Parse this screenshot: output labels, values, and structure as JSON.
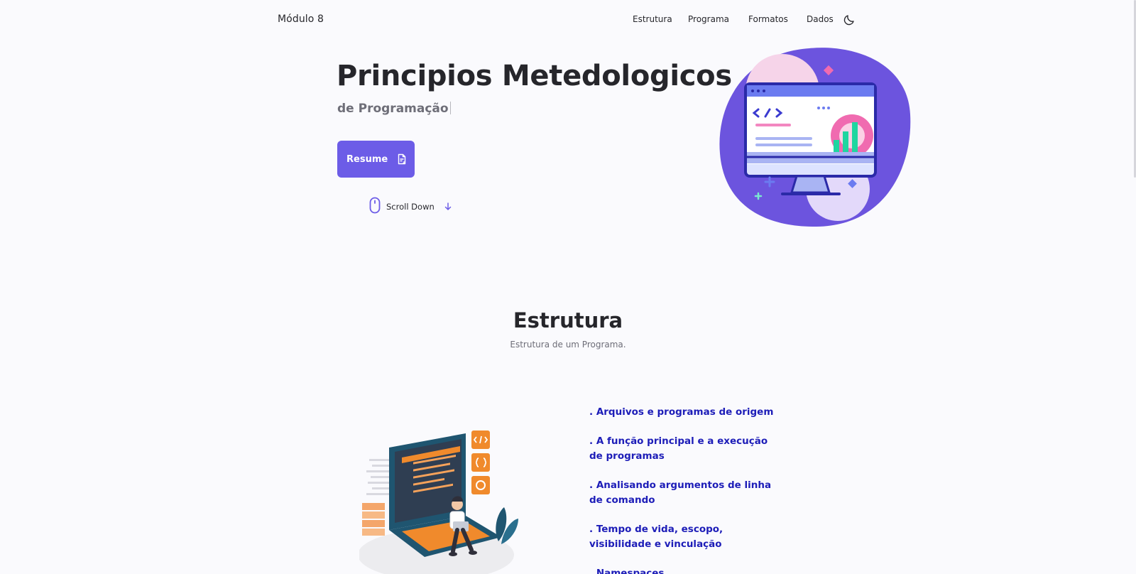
{
  "header": {
    "logo": "Módulo 8",
    "nav": [
      {
        "label": "Estrutura"
      },
      {
        "label": "Programa"
      },
      {
        "label": "Formatos"
      },
      {
        "label": "Dados"
      }
    ]
  },
  "hero": {
    "title": "Principios Metedologicos",
    "subtitle": "de Programação",
    "resume_button": "Resume",
    "scroll_down": "Scroll Down"
  },
  "section": {
    "title": "Estrutura",
    "subtitle": "Estrutura de um Programa.",
    "topics": [
      ". Arquivos e programas de origem",
      ". A função principal e a execução de programas",
      ". Analisando argumentos de linha de comando",
      ". Tempo de vida, escopo, visibilidade e vinculação",
      ". Namespaces"
    ]
  },
  "colors": {
    "accent": "#6c5ce7",
    "topic_text": "#1d1db8",
    "background": "#fafafd"
  },
  "icons": {
    "theme_toggle": "moon-icon",
    "resume": "document-icon",
    "scroll": "mouse-icon",
    "scroll_arrow": "arrow-down-icon"
  }
}
